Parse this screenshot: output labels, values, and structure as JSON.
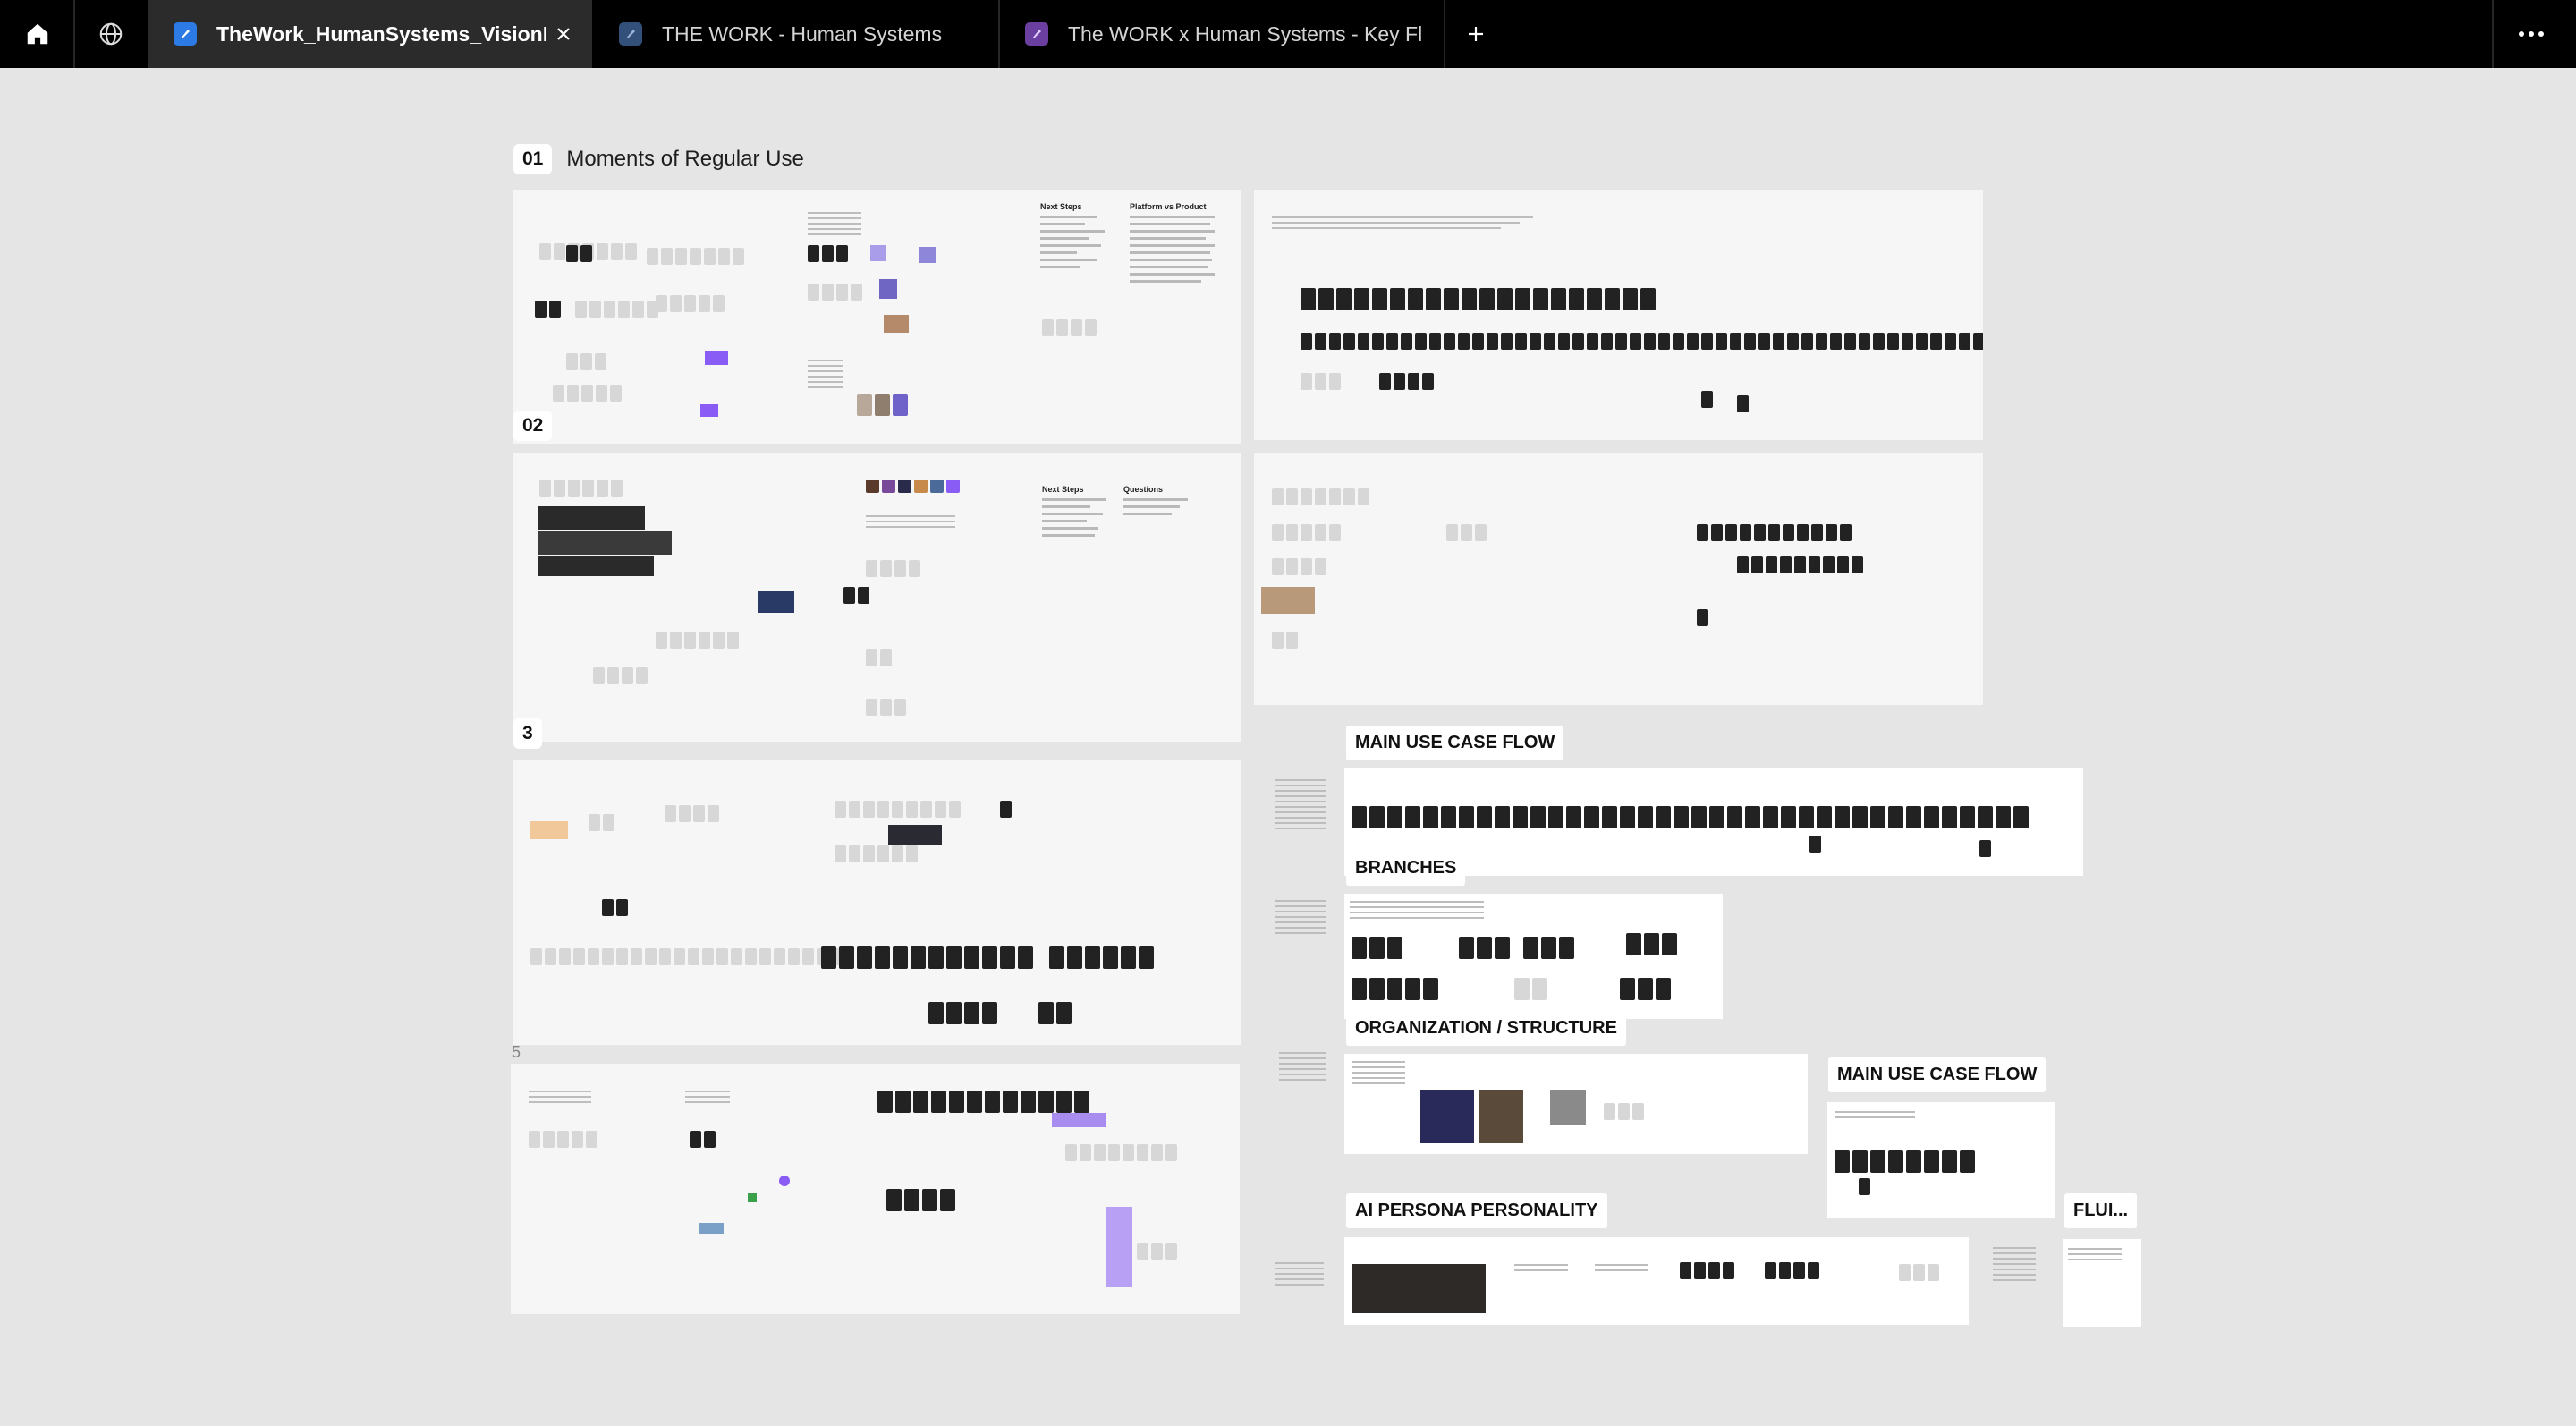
{
  "tabbar": {
    "home_icon": "home-icon",
    "globe_icon": "globe-icon",
    "more_icon": "more-horizontal-icon",
    "new_tab_icon": "plus-icon",
    "tabs": [
      {
        "label": "TheWork_HumanSystems_VisionExploration",
        "active": true,
        "favicon": "figjam-icon",
        "favicon_color": "#2c7be5"
      },
      {
        "label": "THE WORK - Human Systems",
        "active": false,
        "favicon": "figjam-icon",
        "favicon_color": "#33507a"
      },
      {
        "label": "The WORK x Human Systems - Key Flows",
        "active": false,
        "favicon": "figma-slides-icon",
        "favicon_color": "#6b3fa0"
      }
    ]
  },
  "canvas": {
    "section_01": {
      "number": "01",
      "title": "Moments of Regular Use"
    },
    "section_02": {
      "number": "02"
    },
    "section_3": {
      "number": "3"
    },
    "section_5": {
      "number": "5"
    },
    "frames": {
      "f1_next_steps": "Next Steps",
      "f1_platform": "Platform vs Product",
      "f2_next_steps": "Next Steps",
      "f2_questions": "Questions"
    },
    "flow_titles": {
      "main_use_case_flow": "MAIN USE CASE FLOW",
      "branches": "BRANCHES",
      "organization_structure": "ORGANIZATION / STRUCTURE",
      "main_use_case_flow_2": "MAIN USE CASE FLOW",
      "ai_persona_personality": "AI PERSONA PERSONALITY",
      "flui": "FLUI..."
    }
  },
  "colors": {
    "canvas_bg": "#e5e5e5",
    "tabbar_bg": "#000000",
    "active_tab_bg": "#2b2b2b",
    "accent_purple": "#8a5cf6"
  }
}
